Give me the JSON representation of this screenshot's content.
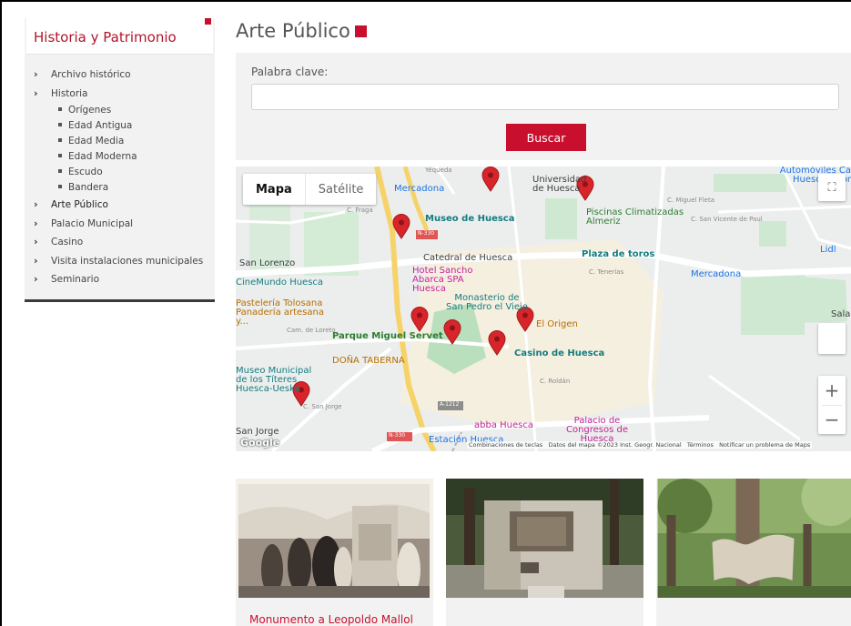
{
  "sidebar": {
    "title": "Historia y Patrimonio",
    "items": [
      {
        "label": "Archivo histórico"
      },
      {
        "label": "Historia",
        "children": [
          {
            "label": "Orígenes"
          },
          {
            "label": "Edad Antigua"
          },
          {
            "label": "Edad Media"
          },
          {
            "label": "Edad Moderna"
          },
          {
            "label": "Escudo"
          },
          {
            "label": "Bandera"
          }
        ]
      },
      {
        "label": "Arte Público",
        "active": true
      },
      {
        "label": "Palacio Municipal"
      },
      {
        "label": "Casino"
      },
      {
        "label": "Visita instalaciones municipales"
      },
      {
        "label": "Seminario"
      }
    ]
  },
  "main": {
    "title": "Arte Público",
    "accent_color": "#c8102e"
  },
  "search": {
    "keyword_label": "Palabra clave:",
    "keyword_value": "",
    "button_label": "Buscar"
  },
  "map": {
    "type_options": [
      "Mapa",
      "Satélite"
    ],
    "selected_type": "Mapa",
    "zoom_in": "+",
    "zoom_out": "−",
    "labels": {
      "mercadona1": "Mercadona",
      "yequeda": "Yéqueda",
      "universidad": "Universidad de Huesca",
      "automoviles": "Automóviles Ca Huesca - Cor",
      "museo": "Museo de Huesca",
      "piscinas": "Piscinas Climatizadas Almeriz",
      "miguel_fleta": "C. Miguel Fleta",
      "san_vicente": "C. San Vicente de Paul",
      "lidl": "Lidl",
      "san_lorenzo": "San Lorenzo",
      "catedral": "Catedral de Huesca",
      "plaza_toros": "Plaza de toros",
      "cinemundo": "CineMundo Huesca",
      "hotel": "Hotel Sancho Abarca SPA Huesca",
      "tenerias": "C. Tenerías",
      "mercadona2": "Mercadona",
      "pasteleria": "Pastelería Tolosana Panadería artesana y...",
      "monasterio": "Monasterio de San Pedro el Viejo",
      "el_origen": "El Origen",
      "sala": "Sala",
      "parque": "Parque Miguel Servet",
      "casino": "Casino de Huesca",
      "dona_taberna": "DOÑA TABERNA",
      "museo_municipal": "Museo Municipal de los Títeres Huesca-Ueska",
      "abba": "abba Huesca",
      "congresos": "Palacio de Congresos de Huesca",
      "san_jorge": "San Jorge",
      "estacion": "Estación Huesca",
      "n330a": "N-330",
      "n330b": "N-330",
      "a1212": "A-1212",
      "fraga": "C. Fraga",
      "cam_loreto": "Cam. de Loreto",
      "san_jorge_st": "C. San Jorge",
      "roldan": "C. Roldán"
    },
    "google": "Google",
    "attribution": {
      "shortcuts": "Combinaciones de teclas",
      "data": "Datos del mapa ©2023 Inst. Geogr. Nacional",
      "terms": "Términos",
      "report": "Notificar un problema de Maps"
    }
  },
  "cards": [
    {
      "title": "Monumento a Leopoldo Mallol"
    },
    {
      "title": ""
    },
    {
      "title": ""
    }
  ]
}
